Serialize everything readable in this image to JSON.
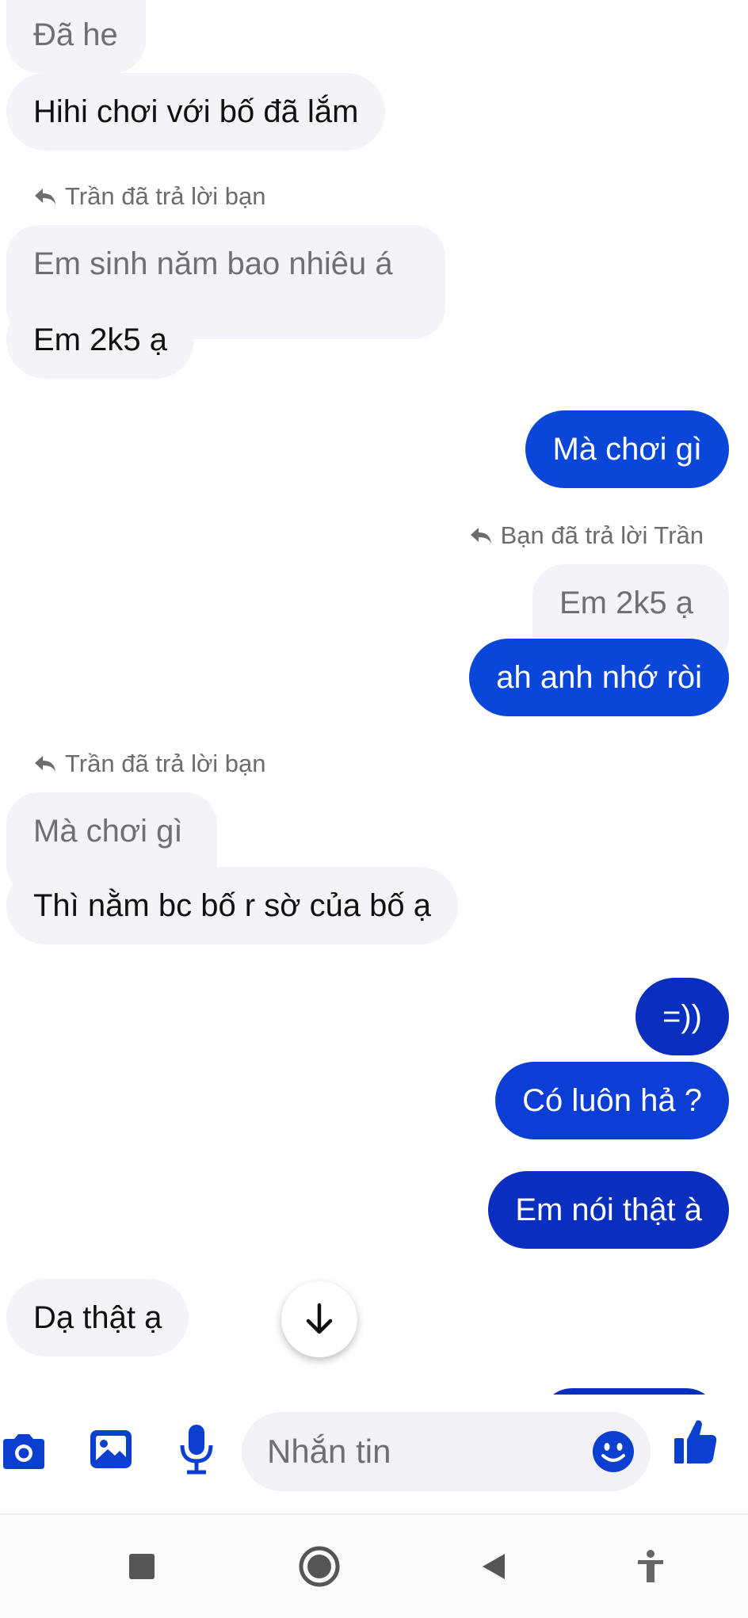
{
  "messages": [
    {
      "text": "Đã he"
    },
    {
      "text": "Hihi chơi với bố đã lắm"
    },
    {
      "reply_note": "Trần đã trả lời bạn"
    },
    {
      "text": "Em sinh năm bao nhiêu á"
    },
    {
      "text": "Em 2k5 ạ"
    },
    {
      "text": "Mà chơi gì"
    },
    {
      "reply_note": "Bạn đã trả lời Trần"
    },
    {
      "text": "Em 2k5 ạ"
    },
    {
      "text": "ah anh nhớ ròi"
    },
    {
      "reply_note": "Trần đã trả lời bạn"
    },
    {
      "text": "Mà chơi gì"
    },
    {
      "text": "Thì nằm bc bố r sờ của bố ạ"
    },
    {
      "text": "=))"
    },
    {
      "text": "Có luôn hả ?"
    },
    {
      "text": "Em nói thật à"
    },
    {
      "text": "Dạ thật ạ"
    }
  ],
  "composer": {
    "placeholder": "Nhắn tin",
    "icons": [
      "camera-icon",
      "image-icon",
      "microphone-icon",
      "emoji-icon",
      "thumbs-up-icon"
    ]
  },
  "system_nav": {
    "icons": [
      "recent-apps-icon",
      "home-icon",
      "back-icon",
      "accessibility-icon"
    ]
  },
  "colors": {
    "accent": "#0a47d8",
    "outgoing_dark": "#0a2fbf",
    "incoming_bg": "#f4f4f8",
    "icon_blue": "#0a3fd0"
  }
}
